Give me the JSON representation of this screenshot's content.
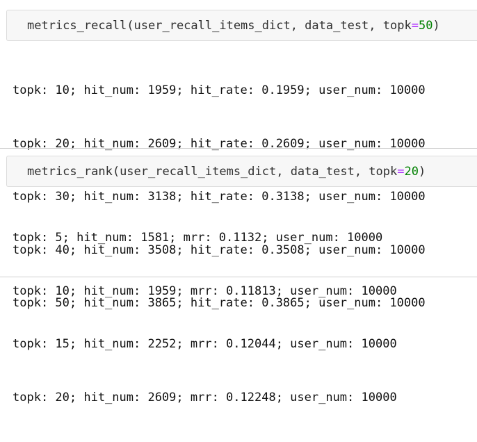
{
  "cell1": {
    "func": "metrics_recall",
    "args": "(user_recall_items_dict, data_test, topk",
    "eq": "=",
    "num": "50",
    "close": ")"
  },
  "output1": [
    "topk: 10; hit_num: 1959; hit_rate: 0.1959; user_num: 10000",
    "topk: 20; hit_num: 2609; hit_rate: 0.2609; user_num: 10000",
    "topk: 30; hit_num: 3138; hit_rate: 0.3138; user_num: 10000",
    "topk: 40; hit_num: 3508; hit_rate: 0.3508; user_num: 10000",
    "topk: 50; hit_num: 3865; hit_rate: 0.3865; user_num: 10000"
  ],
  "cell2": {
    "func": "metrics_rank",
    "args": "(user_recall_items_dict, data_test, topk",
    "eq": "=",
    "num": "20",
    "close": ")"
  },
  "output2": [
    "topk: 5; hit_num: 1581; mrr: 0.1132; user_num: 10000",
    "topk: 10; hit_num: 1959; mrr: 0.11813; user_num: 10000",
    "topk: 15; hit_num: 2252; mrr: 0.12044; user_num: 10000",
    "topk: 20; hit_num: 2609; mrr: 0.12248; user_num: 10000"
  ],
  "colors": {
    "input_bg": "#f7f7f7",
    "operator": "#aa22ff",
    "number": "#008000"
  }
}
